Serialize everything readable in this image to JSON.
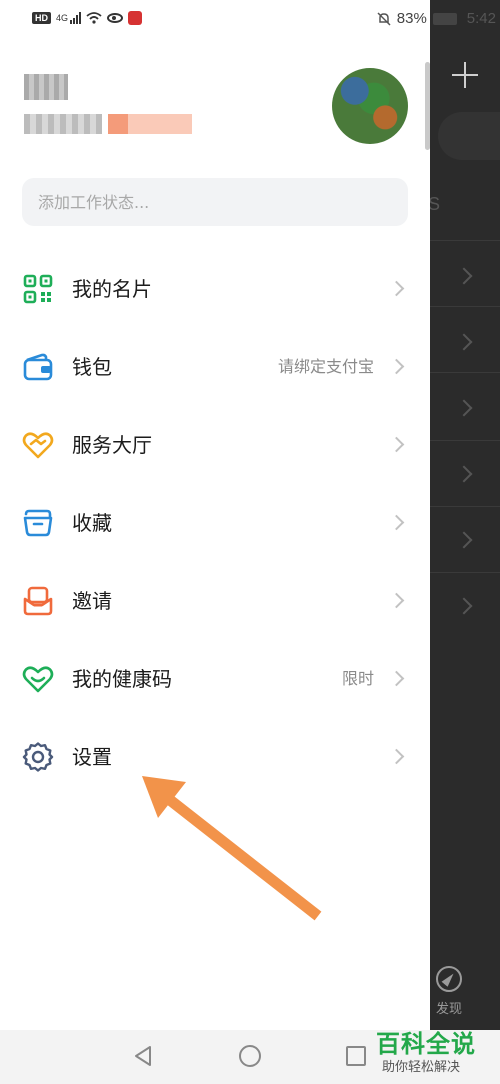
{
  "status_bar": {
    "hd": "HD",
    "network": "4G",
    "battery_percent": "83%",
    "time": "5:42"
  },
  "drawer": {
    "status_input_placeholder": "添加工作状态...",
    "menu": [
      {
        "label": "我的名片",
        "hint": "",
        "icon": "qr-code-icon",
        "color": "#1eae58"
      },
      {
        "label": "钱包",
        "hint": "请绑定支付宝",
        "icon": "wallet-icon",
        "color": "#2a8bd9"
      },
      {
        "label": "服务大厅",
        "hint": "",
        "icon": "heart-handshake-icon",
        "color": "#f2a81e"
      },
      {
        "label": "收藏",
        "hint": "",
        "icon": "folder-icon",
        "color": "#2a8bd9"
      },
      {
        "label": "邀请",
        "hint": "",
        "icon": "invite-icon",
        "color": "#f06a3c"
      },
      {
        "label": "我的健康码",
        "hint": "限时",
        "icon": "health-heart-icon",
        "color": "#1eae58"
      },
      {
        "label": "设置",
        "hint": "",
        "icon": "gear-icon",
        "color": "#4a5a7a"
      }
    ]
  },
  "background_app": {
    "discover_label": "发现"
  },
  "watermark": {
    "title": "百科全说",
    "subtitle": "助你轻松解决"
  },
  "colors": {
    "annotation_arrow": "#f2934a",
    "watermark_green": "#23a84a"
  }
}
